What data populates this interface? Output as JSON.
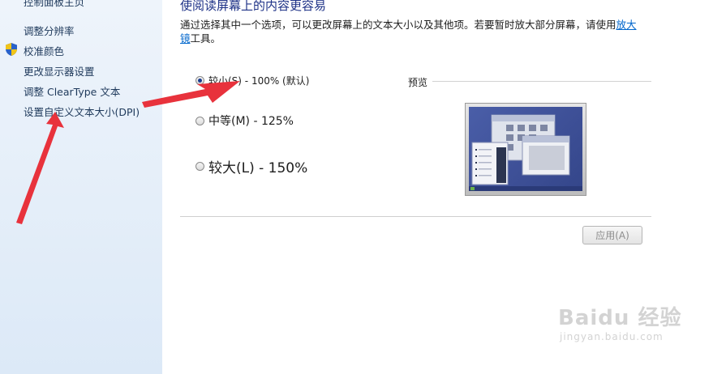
{
  "sidebar": {
    "items": [
      {
        "label": "控制面板主页"
      },
      {
        "label": "调整分辨率"
      },
      {
        "label": "校准颜色"
      },
      {
        "label": "更改显示器设置"
      },
      {
        "label": "调整 ClearType 文本"
      },
      {
        "label": "设置自定义文本大小(DPI)"
      }
    ],
    "shield_icon": "uac-shield-icon"
  },
  "main": {
    "heading": "使阅读屏幕上的内容更容易",
    "description_before_link": "通过选择其中一个选项，可以更改屏幕上的文本大小以及其他项。若要暂时放大部分屏幕，请使用",
    "description_link": "放大镜",
    "description_after_link": "工具。",
    "options": [
      {
        "label": "较小(S) - 100% (默认)",
        "selected": true
      },
      {
        "label": "中等(M) - 125%",
        "selected": false
      },
      {
        "label": "较大(L) - 150%",
        "selected": false
      }
    ],
    "preview_label": "预览",
    "apply_button": "应用(A)",
    "apply_enabled": false
  },
  "watermark": {
    "main": "Baidu 经验",
    "sub": "jingyan.baidu.com"
  },
  "colors": {
    "sidebar_bg": "#dce9f7",
    "heading": "#1e3287",
    "link": "#0066cc",
    "annotation_arrow": "#e8323c",
    "screen_bg": "#3d4f96"
  }
}
